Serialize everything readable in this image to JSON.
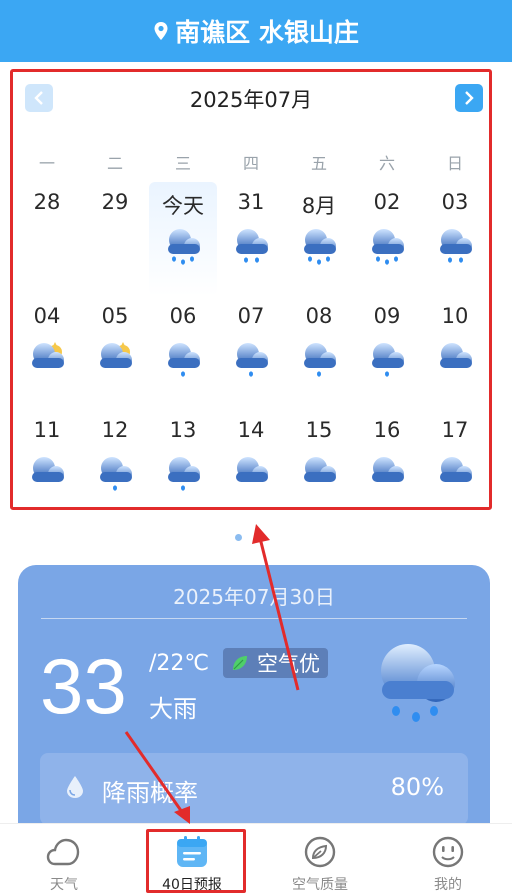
{
  "header": {
    "location": "南谯区 水银山庄"
  },
  "calendar": {
    "month_title": "2025年07月",
    "weekdays": [
      "一",
      "二",
      "三",
      "四",
      "五",
      "六",
      "日"
    ],
    "weeks": [
      [
        {
          "label": "28",
          "icon": ""
        },
        {
          "label": "29",
          "icon": ""
        },
        {
          "label": "今天",
          "icon": "heavy-rain-icon",
          "today": true
        },
        {
          "label": "31",
          "icon": "rain-icon"
        },
        {
          "label": "8月",
          "icon": "heavy-rain-icon"
        },
        {
          "label": "02",
          "icon": "heavy-rain-icon"
        },
        {
          "label": "03",
          "icon": "rain-icon"
        }
      ],
      [
        {
          "label": "04",
          "icon": "partly-cloudy-icon"
        },
        {
          "label": "05",
          "icon": "partly-cloudy-icon"
        },
        {
          "label": "06",
          "icon": "light-rain-icon"
        },
        {
          "label": "07",
          "icon": "light-rain-icon"
        },
        {
          "label": "08",
          "icon": "light-rain-icon"
        },
        {
          "label": "09",
          "icon": "light-rain-icon"
        },
        {
          "label": "10",
          "icon": "cloudy-icon"
        }
      ],
      [
        {
          "label": "11",
          "icon": "cloudy-icon"
        },
        {
          "label": "12",
          "icon": "light-rain-icon"
        },
        {
          "label": "13",
          "icon": "light-rain-icon"
        },
        {
          "label": "14",
          "icon": "cloudy-icon"
        },
        {
          "label": "15",
          "icon": "cloudy-icon"
        },
        {
          "label": "16",
          "icon": "cloudy-icon"
        },
        {
          "label": "17",
          "icon": "cloudy-icon"
        }
      ]
    ]
  },
  "today_card": {
    "date": "2025年07月30日",
    "temp": "33",
    "low": "/22℃",
    "air_quality": "空气优",
    "description": "大雨",
    "rain_label": "降雨概率",
    "rain_value": "80%"
  },
  "tabs": [
    {
      "label": "天气",
      "icon": "cloud-icon"
    },
    {
      "label": "40日预报",
      "icon": "calendar-icon",
      "active": true
    },
    {
      "label": "空气质量",
      "icon": "leaf-icon"
    },
    {
      "label": "我的",
      "icon": "smiley-icon"
    }
  ],
  "colors": {
    "accent": "#3ba7f3",
    "card": "#7aa6e6",
    "highlight": "#e22b2b"
  }
}
